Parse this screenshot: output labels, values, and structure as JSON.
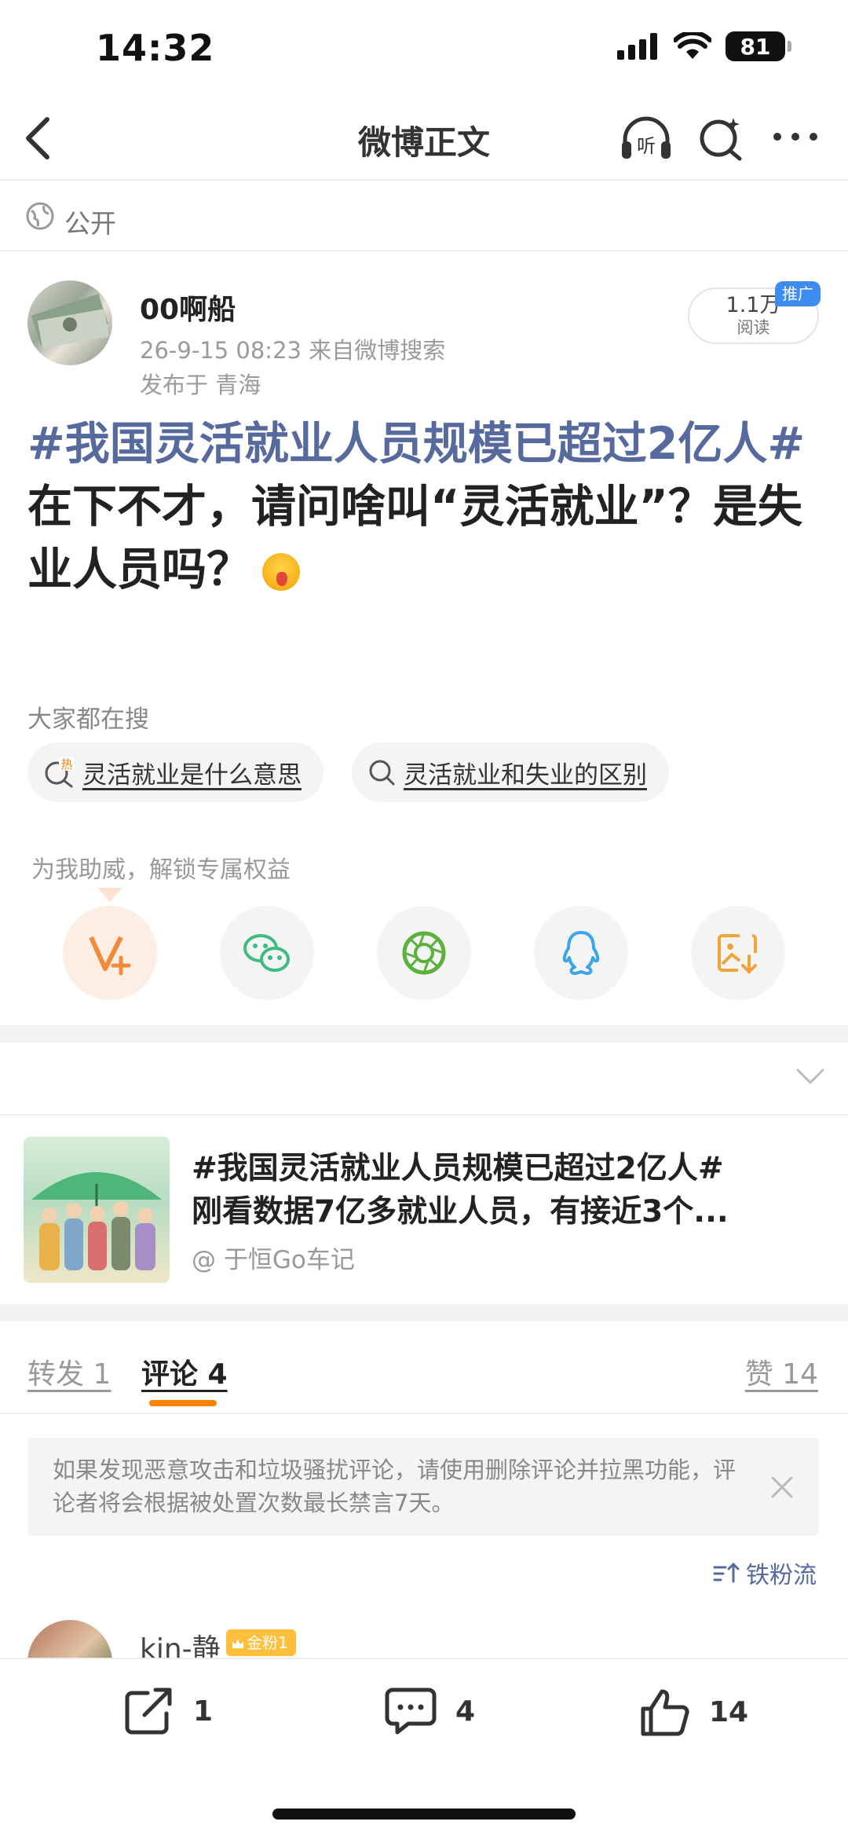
{
  "status_bar": {
    "time": "14:32",
    "battery": "81"
  },
  "nav": {
    "title": "微博正文"
  },
  "visibility": {
    "label": "公开"
  },
  "author": {
    "name": "00啊船",
    "time_source": "26-9-15 08:23  来自微博搜索",
    "location": "发布于 青海",
    "reads_count": "1.1万",
    "reads_label": "阅读",
    "promo_tag": "推广"
  },
  "post": {
    "topic": "#我国灵活就业人员规模已超过2亿人#",
    "body": "在下不才，请问啥叫“灵活就业”？是失业人员吗？"
  },
  "search_suggest": {
    "label": "大家都在搜",
    "chips": [
      "灵活就业是什么意思",
      "灵活就业和失业的区别"
    ],
    "hot_tag": "热"
  },
  "share": {
    "label": "为我助威，解锁专属权益",
    "targets": [
      "vplus-icon",
      "wechat-icon",
      "moments-icon",
      "qq-icon",
      "save-image-icon"
    ]
  },
  "related": {
    "title_line1": "#我国灵活就业人员规模已超过2亿人#",
    "title_line2": "刚看数据7亿多就业人员，有接近3个...",
    "source": "@ 于恒Go车记"
  },
  "tabs": {
    "repost": "转发 1",
    "comment": "评论 4",
    "like": "赞 14"
  },
  "notice": {
    "text": "如果发现恶意攻击和垃圾骚扰评论，请使用删除评论并拉黑功能，评论者将会根据被处置次数最长禁言7天。"
  },
  "sort": {
    "label": "铁粉流"
  },
  "comment": {
    "name": "kin-静",
    "badge": "金粉1"
  },
  "bottom_bar": {
    "repost_count": "1",
    "comment_count": "4",
    "like_count": "14"
  },
  "colors": {
    "topic_blue": "#566a9e",
    "accent_orange": "#ff8200",
    "promo_blue": "#3e8cf0"
  }
}
